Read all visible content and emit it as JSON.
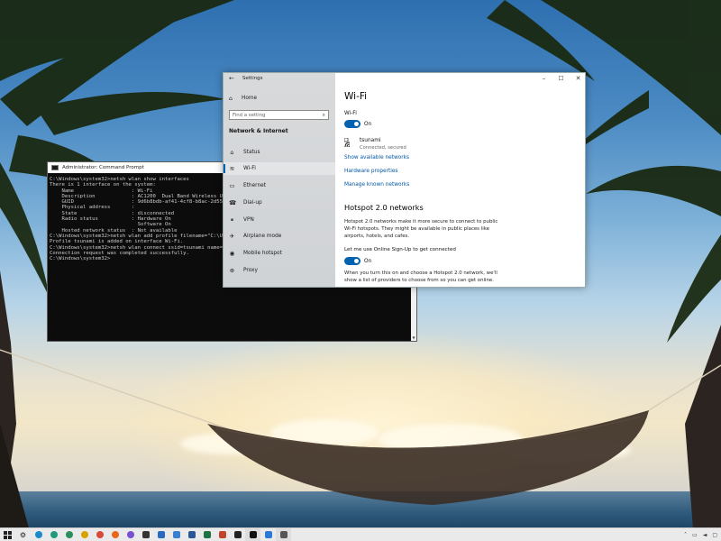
{
  "cmd": {
    "title": "Administrator: Command Prompt",
    "lines": [
      "C:\\Windows\\system32>netsh wlan show interfaces",
      "",
      "There is 1 interface on the system:",
      "",
      "    Name                   : Wi-Fi",
      "    Description            : AC1200  Dual Band Wireless USB Ad",
      "    GUID                   : 9d6b8bdb-af41-4cf8-b8ac-2d55f5b8",
      "    Physical address       : ",
      "    State                  : disconnected",
      "    Radio status           : Hardware On",
      "                             Software On",
      "",
      "    Hosted network status  : Not available",
      "",
      "",
      "C:\\Windows\\system32>netsh wlan add profile filename=\"C:\\Users\\",
      "Profile tsunami is added on interface Wi-Fi.",
      "",
      "C:\\Windows\\system32>netsh wlan connect ssid=tsunami name=tsuna",
      "Connection request was completed successfully.",
      "",
      "C:\\Windows\\system32>"
    ]
  },
  "settings": {
    "window_title": "Settings",
    "home": "Home",
    "search_placeholder": "Find a setting",
    "section": "Network & Internet",
    "nav": [
      {
        "label": "Status",
        "icon": "status-icon"
      },
      {
        "label": "Wi-Fi",
        "icon": "wifi-icon"
      },
      {
        "label": "Ethernet",
        "icon": "ethernet-icon"
      },
      {
        "label": "Dial-up",
        "icon": "dialup-icon"
      },
      {
        "label": "VPN",
        "icon": "vpn-icon"
      },
      {
        "label": "Airplane mode",
        "icon": "airplane-icon"
      },
      {
        "label": "Mobile hotspot",
        "icon": "hotspot-icon"
      },
      {
        "label": "Proxy",
        "icon": "proxy-icon"
      }
    ],
    "active_nav": "Wi-Fi",
    "page_title": "Wi-Fi",
    "wifi_label": "Wi-Fi",
    "wifi_toggle": "On",
    "network": {
      "name": "tsunami",
      "status": "Connected, secured"
    },
    "links": {
      "show_available": "Show available networks",
      "hardware": "Hardware properties",
      "manage_known": "Manage known networks"
    },
    "hotspot": {
      "title": "Hotspot 2.0 networks",
      "description": "Hotspot 2.0 networks make it more secure to connect to public Wi-Fi hotspots. They might be available in public places like airports, hotels, and cafes.",
      "signup_label": "Let me use Online Sign-Up to get connected",
      "signup_toggle": "On",
      "footer": "When you turn this on and choose a Hotspot 2.0 network, we'll show a list of providers to choose from so you can get online."
    },
    "accent": "#0063b1"
  },
  "taskbar": {
    "icons": [
      {
        "name": "taskbar-edge-icon",
        "color": "#1d8acb"
      },
      {
        "name": "taskbar-edge-beta-icon",
        "color": "#1f9a7a"
      },
      {
        "name": "taskbar-edge-dev-icon",
        "color": "#2a8f5a"
      },
      {
        "name": "taskbar-edge-canary-icon",
        "color": "#d6a300"
      },
      {
        "name": "taskbar-chrome-icon",
        "color": "#d94a3a"
      },
      {
        "name": "taskbar-firefox-icon",
        "color": "#e8661d"
      },
      {
        "name": "taskbar-firefox-nightly-icon",
        "color": "#7b4fd1"
      },
      {
        "name": "taskbar-store-icon",
        "color": "#333333"
      },
      {
        "name": "taskbar-mail-icon",
        "color": "#2a6ac0"
      },
      {
        "name": "taskbar-photos-icon",
        "color": "#3a7fd0"
      },
      {
        "name": "taskbar-word-icon",
        "color": "#2b5797"
      },
      {
        "name": "taskbar-excel-icon",
        "color": "#1e7145"
      },
      {
        "name": "taskbar-powerpoint-icon",
        "color": "#c1452a"
      },
      {
        "name": "taskbar-terminal-icon",
        "color": "#222222"
      },
      {
        "name": "taskbar-command-prompt-icon",
        "color": "#111111"
      },
      {
        "name": "taskbar-paint-icon",
        "color": "#2d7ad6"
      },
      {
        "name": "taskbar-settings-icon",
        "color": "#555555"
      }
    ]
  }
}
